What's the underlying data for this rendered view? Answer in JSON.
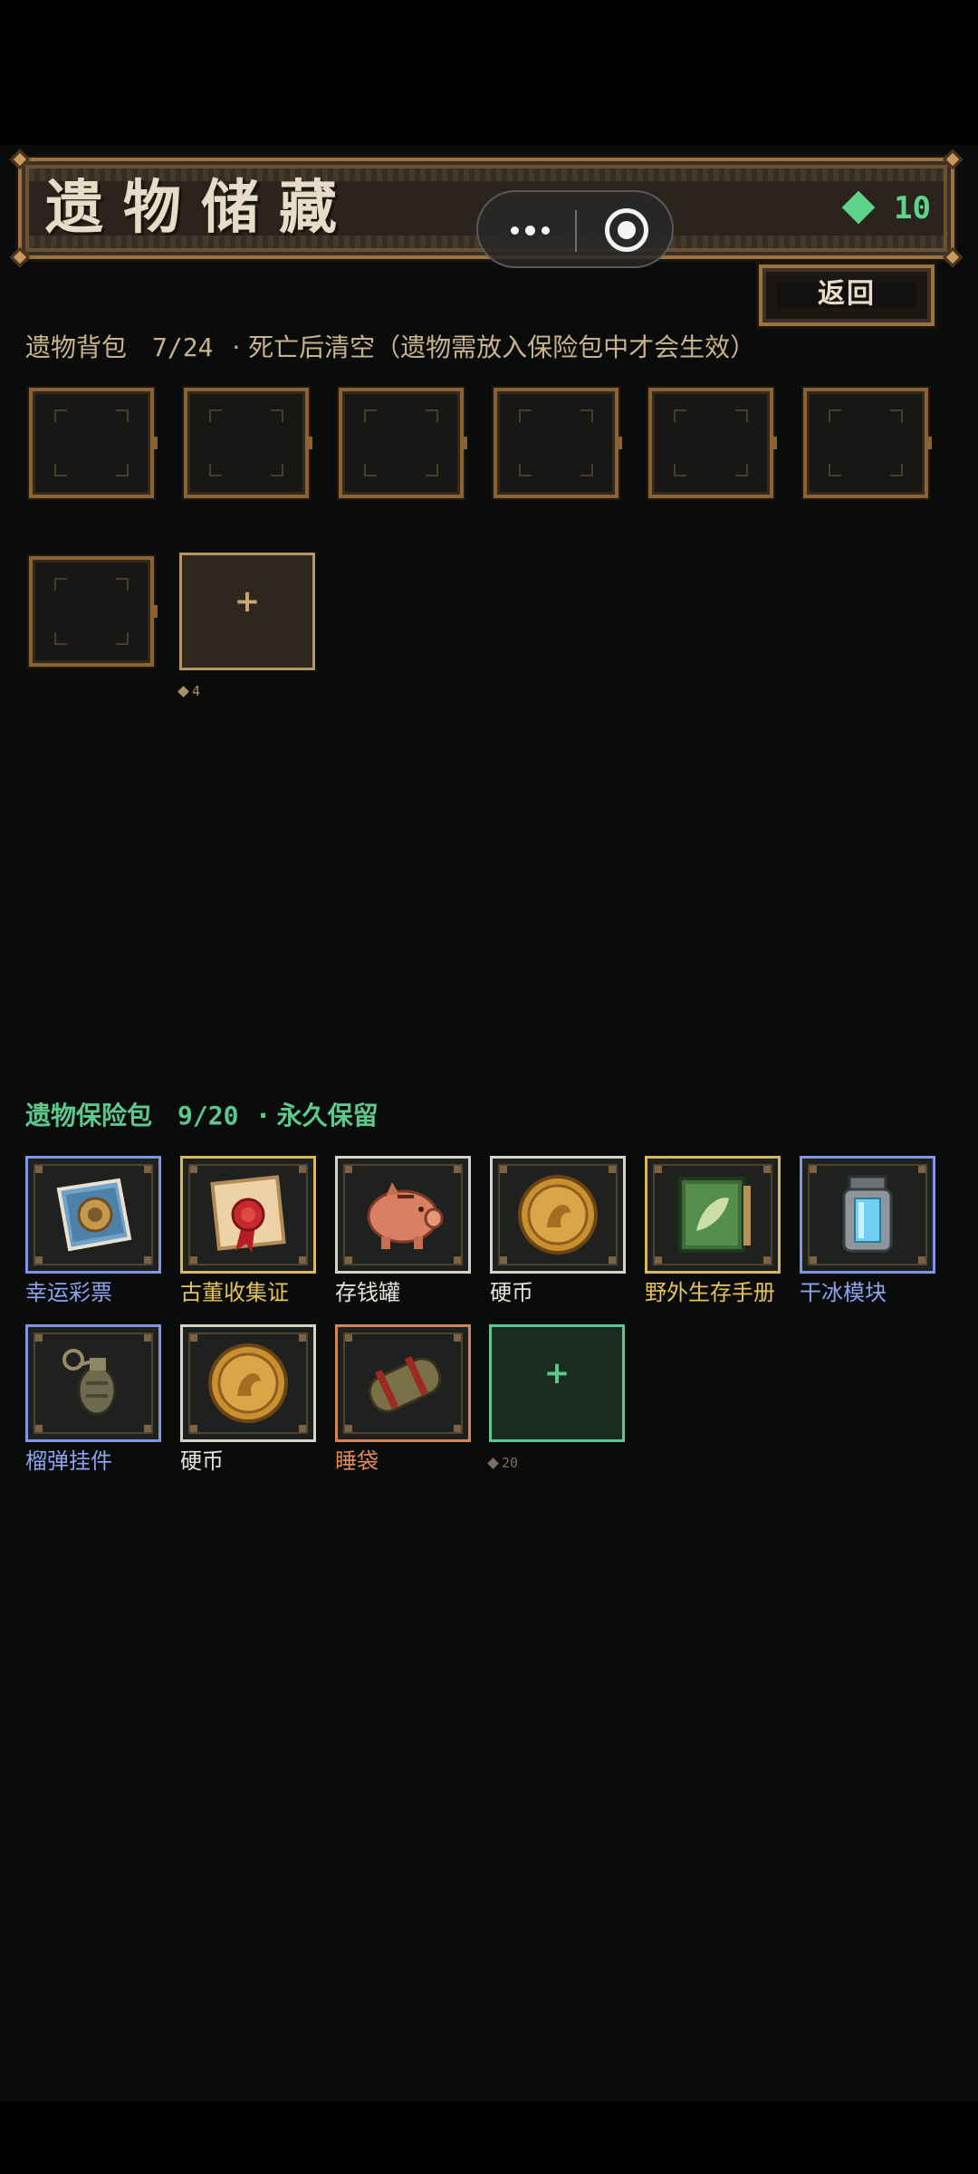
{
  "header": {
    "title": "遗物储藏",
    "gem_count": "10"
  },
  "back_button": "返回",
  "relic_bag": {
    "title": "遗物背包",
    "count": "7/24",
    "note": "· 死亡后清空（遗物需放入保险包中才会生效）",
    "add_cost": "4"
  },
  "insurance_bag": {
    "title": "遗物保险包",
    "count": "9/20",
    "note": "· 永久保留",
    "add_cost": "20",
    "items": [
      {
        "name": "幸运彩票",
        "rarity": "blue",
        "icon": "lottery-ticket-icon"
      },
      {
        "name": "古董收集证",
        "rarity": "gold",
        "icon": "sealed-certificate-icon"
      },
      {
        "name": "存钱罐",
        "rarity": "white",
        "icon": "piggy-bank-icon"
      },
      {
        "name": "硬币",
        "rarity": "white",
        "icon": "coin-icon"
      },
      {
        "name": "野外生存手册",
        "rarity": "gold",
        "icon": "survival-manual-icon"
      },
      {
        "name": "干冰模块",
        "rarity": "blue",
        "icon": "dry-ice-canister-icon"
      },
      {
        "name": "榴弹挂件",
        "rarity": "blue",
        "icon": "grenade-pendant-icon"
      },
      {
        "name": "硬币",
        "rarity": "white",
        "icon": "coin-icon"
      },
      {
        "name": "睡袋",
        "rarity": "orange",
        "icon": "sleeping-bag-icon"
      }
    ]
  },
  "colors": {
    "gem": "#5ed38a",
    "rarity_blue": "#7f96e6",
    "rarity_gold": "#d8b85e",
    "rarity_white": "#d7d2c7",
    "rarity_orange": "#d2845b"
  }
}
